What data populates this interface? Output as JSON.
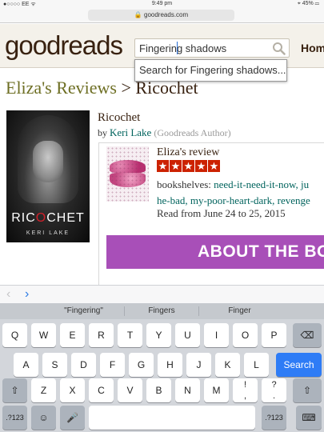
{
  "status": {
    "carrier": "●○○○○ EE ᯤ",
    "time": "9:49 pm",
    "battery": "⌖ 45% ▭"
  },
  "browser": {
    "url": "🔒 goodreads.com"
  },
  "header": {
    "logo": "goodreads",
    "search_value": "Fingering shadows",
    "nav_home": "Hom"
  },
  "suggestion": {
    "text": "Search for Fingering shadows..."
  },
  "page": {
    "title_crumb": "Eliza's Reviews",
    "title_sep": " > ",
    "title_book": "Ricochet"
  },
  "book": {
    "title": "Ricochet",
    "by": "by ",
    "author": "Keri Lake",
    "author_note": " (Goodreads Author)",
    "cover_title_a": "RIC",
    "cover_title_o": "O",
    "cover_title_b": "CHET",
    "cover_author": "KERI LAKE"
  },
  "review": {
    "heading": "Eliza's review",
    "rating": 5,
    "shelves_label": "bookshelves: ",
    "shelves_line1": "need-it-need-it-now, ju",
    "shelves_line2": "he-bad, my-poor-heart-dark, revenge",
    "read_dates": "Read from June 24 to 25, 2015",
    "banner_text": "ABOUT THE BO"
  },
  "accessory": {
    "prev": "‹",
    "next": "›"
  },
  "keyboard": {
    "suggestions": [
      "\"Fingering\"",
      "Fingers",
      "Finger"
    ],
    "row1": [
      "Q",
      "W",
      "E",
      "R",
      "T",
      "Y",
      "U",
      "I",
      "O",
      "P"
    ],
    "row2": [
      "A",
      "S",
      "D",
      "F",
      "G",
      "H",
      "J",
      "K",
      "L"
    ],
    "row3": [
      "Z",
      "X",
      "C",
      "V",
      "B",
      "N",
      "M"
    ],
    "punct1_top": "!",
    "punct1_bottom": ",",
    "punct2_top": "?",
    "punct2_bottom": ".",
    "backspace": "⌫",
    "search": "Search",
    "shift": "⇧",
    "numbers": ".?123",
    "emoji": "☺",
    "mic": "🎤",
    "hide": "⌨"
  },
  "colors": {
    "brand_brown": "#382110",
    "link_green": "#00635d",
    "star_red": "#cc2200",
    "banner_purple": "#a84fb8",
    "key_blue": "#2e7cf6"
  }
}
